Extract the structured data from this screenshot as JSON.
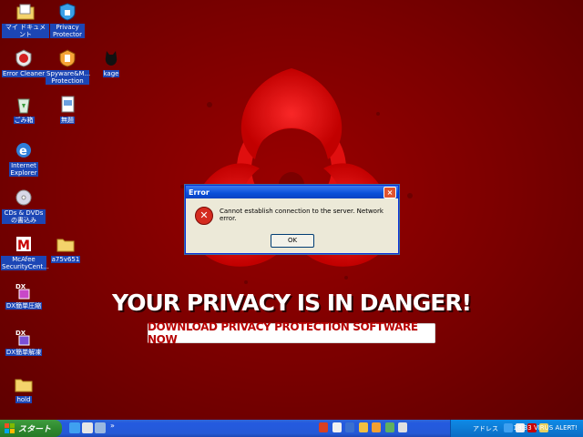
{
  "desktop_icons": [
    {
      "label": "マイ ドキュメント",
      "icon": "documents-folder-icon"
    },
    {
      "label": "Privacy Protector",
      "icon": "privacy-protector-icon"
    },
    {
      "label": "Error Cleaner",
      "icon": "error-cleaner-icon"
    },
    {
      "label": "Spyware&M... Protection",
      "icon": "spyware-protection-icon"
    },
    {
      "label": "kage",
      "icon": "kage-icon"
    },
    {
      "label": "ごみ箱",
      "icon": "recycle-bin-icon"
    },
    {
      "label": "無題",
      "icon": "document-icon"
    },
    {
      "label": "Internet Explorer",
      "icon": "ie-icon"
    },
    {
      "label": "CDs & DVDs の書込み",
      "icon": "cd-icon"
    },
    {
      "label": "McAfee SecurityCent...",
      "icon": "mcafee-icon"
    },
    {
      "label": "a75v651",
      "icon": "folder-icon"
    },
    {
      "label": "DX簡単圧縮",
      "icon": "dx-compress-icon"
    },
    {
      "label": "DX簡単解凍",
      "icon": "dx-extract-icon"
    },
    {
      "label": "hold",
      "icon": "folder-icon"
    }
  ],
  "banner": {
    "headline": "YOUR PRIVACY IS IN DANGER!",
    "download_button": "DOWNLOAD PRIVACY PROTECTION SOFTWARE NOW"
  },
  "dialog": {
    "title": "Error",
    "message": "Cannot establish connection to the server. Network error.",
    "ok_label": "OK",
    "close_label": "×"
  },
  "taskbar": {
    "start_label": "スタート",
    "address_label": "アドレス",
    "clock": "18:33",
    "alert": "VIRUS ALERT!"
  },
  "colors": {
    "background": "#7a0000",
    "selection": "#1c46b5",
    "taskbar": "#245ae0",
    "start": "#2f8a2f",
    "danger_text": "#b50000"
  }
}
